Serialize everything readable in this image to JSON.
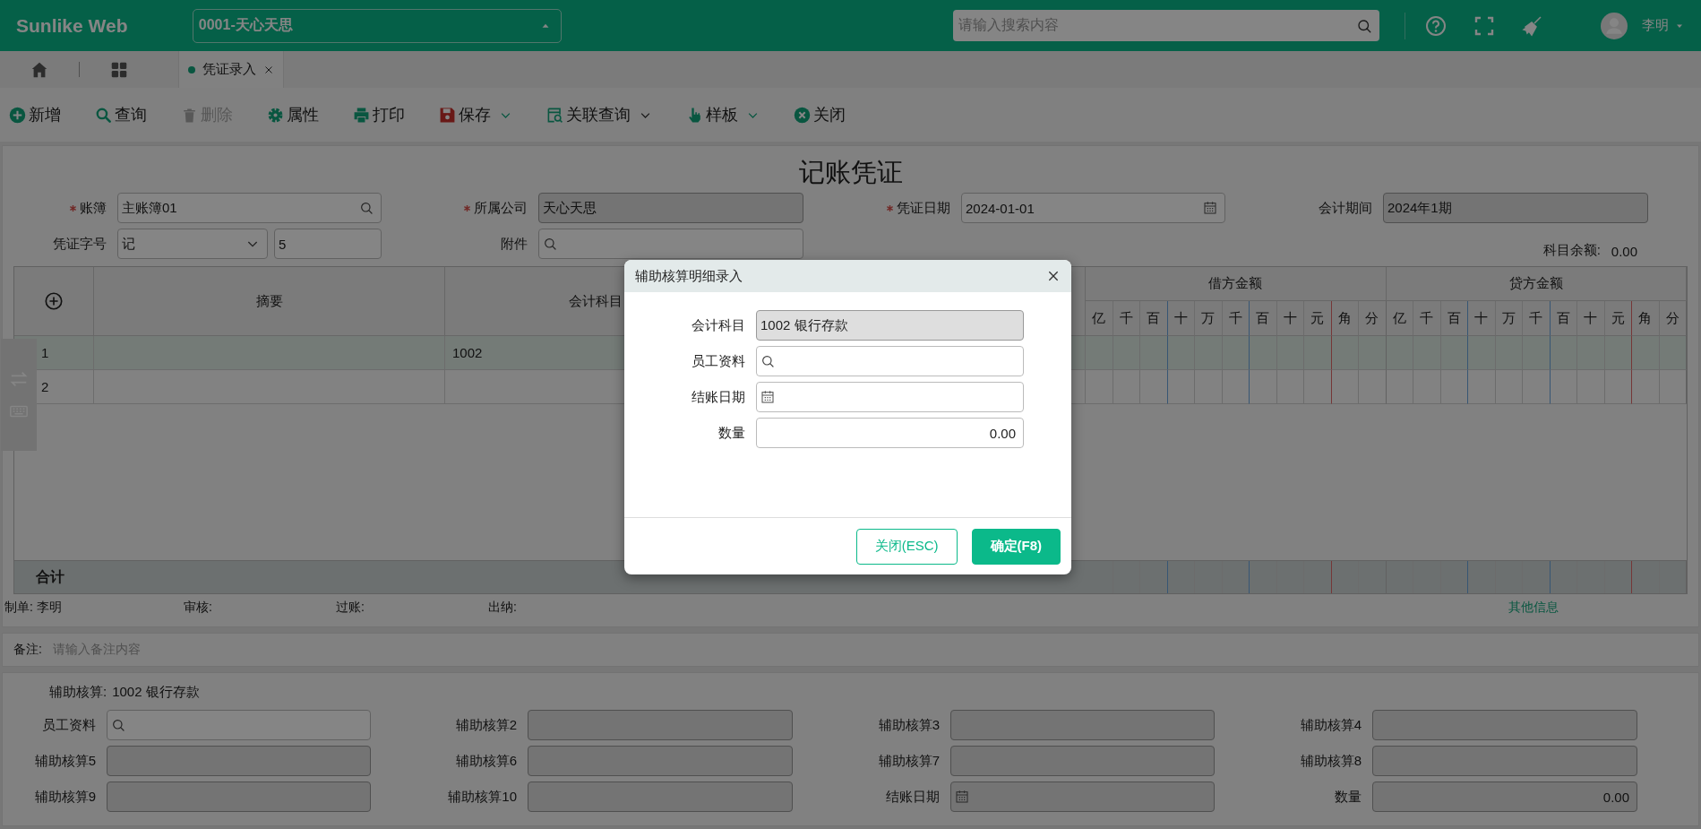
{
  "top_bar": {
    "brand": "Sunlike Web",
    "company_select": "0001-天心天思",
    "search": {
      "placeholder": "请输入搜索内容"
    },
    "user": "李明"
  },
  "tabs": [
    {
      "label": "凭证录入",
      "selected": true
    }
  ],
  "toolbar": [
    {
      "label": "新增",
      "kind": "add",
      "disabled": false,
      "dropdown": false
    },
    {
      "label": "查询",
      "kind": "search",
      "disabled": false,
      "dropdown": false
    },
    {
      "label": "删除",
      "kind": "delete",
      "disabled": true,
      "dropdown": false
    },
    {
      "label": "属性",
      "kind": "gear",
      "disabled": false,
      "dropdown": false
    },
    {
      "label": "打印",
      "kind": "print",
      "disabled": false,
      "dropdown": false
    },
    {
      "label": "保存",
      "kind": "save",
      "disabled": false,
      "dropdown": true
    },
    {
      "label": "关联查询",
      "kind": "related",
      "disabled": false,
      "dropdown": true
    },
    {
      "label": "样板",
      "kind": "hand",
      "disabled": false,
      "dropdown": true
    },
    {
      "label": "关闭",
      "kind": "close",
      "disabled": false,
      "dropdown": false
    }
  ],
  "voucher": {
    "title": "记账凭证",
    "fields": [
      {
        "label": "账簿",
        "required": true,
        "kind": "search",
        "readonly": false,
        "value": "主账簿01"
      },
      {
        "label": "所属公司",
        "required": true,
        "kind": "text",
        "readonly": true,
        "value": "天心天思"
      },
      {
        "label": "凭证日期",
        "required": true,
        "kind": "date",
        "readonly": false,
        "value": "2024-01-01"
      },
      {
        "label": "会计期间",
        "required": false,
        "kind": "text",
        "readonly": true,
        "value": "2024年1期"
      }
    ],
    "voucher_type": {
      "label": "凭证字号",
      "type_value": "记",
      "number_value": "5"
    },
    "attachment": {
      "label": "附件"
    },
    "balance": {
      "label": "科目余额:",
      "value": "0.00"
    }
  },
  "table": {
    "columns": [
      "摘要",
      "会计科目"
    ],
    "debit": {
      "label": "借方金额",
      "digits": [
        "亿",
        "千",
        "百",
        "十",
        "万",
        "千",
        "百",
        "十",
        "元",
        "角",
        "分"
      ]
    },
    "credit": {
      "label": "贷方金额",
      "digits": [
        "亿",
        "千",
        "百",
        "十",
        "万",
        "千",
        "百",
        "十",
        "元",
        "角",
        "分"
      ]
    },
    "rows": [
      {
        "index": "1",
        "account": "1002",
        "selected": true
      },
      {
        "index": "2",
        "selected": false
      }
    ],
    "total_label": "合计"
  },
  "signatures": [
    {
      "label": "制单:",
      "value": "李明"
    },
    {
      "label": "审核:"
    },
    {
      "label": "过账:"
    },
    {
      "label": "出纳:"
    }
  ],
  "other_info": "其他信息",
  "remark": {
    "label": "备注:",
    "placeholder": "请输入备注内容"
  },
  "auxiliary": {
    "label": "辅助核算:",
    "account": "1002 银行存款",
    "fields": [
      {
        "label": "员工资料",
        "kind": "search",
        "readonly": false
      },
      {
        "label": "辅助核算2",
        "kind": "text",
        "readonly": true
      },
      {
        "label": "辅助核算3",
        "kind": "text",
        "readonly": true
      },
      {
        "label": "辅助核算4",
        "kind": "text",
        "readonly": true
      },
      {
        "label": "辅助核算5",
        "kind": "text",
        "readonly": true
      },
      {
        "label": "辅助核算6",
        "kind": "text",
        "readonly": true
      },
      {
        "label": "辅助核算7",
        "kind": "text",
        "readonly": true
      },
      {
        "label": "辅助核算8",
        "kind": "text",
        "readonly": true
      },
      {
        "label": "辅助核算9",
        "kind": "text",
        "readonly": true
      },
      {
        "label": "辅助核算10",
        "kind": "text",
        "readonly": true
      },
      {
        "label": "结账日期",
        "kind": "date",
        "readonly": true
      },
      {
        "label": "数量",
        "kind": "number",
        "readonly": true,
        "value": "0.00"
      }
    ]
  },
  "dialog": {
    "title": "辅助核算明细录入",
    "fields": [
      {
        "label": "会计科目",
        "kind": "text",
        "readonly": true,
        "value": "1002 银行存款"
      },
      {
        "label": "员工资料",
        "kind": "search",
        "readonly": false
      },
      {
        "label": "结账日期",
        "kind": "date",
        "readonly": false
      },
      {
        "label": "数量",
        "kind": "number",
        "readonly": false,
        "value": "0.00"
      }
    ],
    "buttons": [
      {
        "label": "关闭(ESC)",
        "kind": "secondary"
      },
      {
        "label": "确定(F8)",
        "kind": "primary"
      }
    ]
  }
}
